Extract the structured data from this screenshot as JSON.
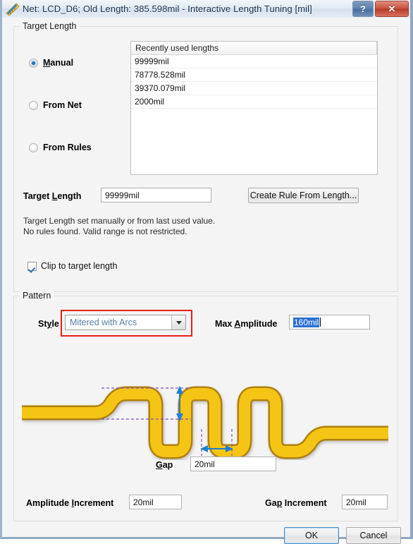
{
  "window": {
    "title": "Net: LCD_D6;  Old Length: 385.598mil -  Interactive Length Tuning [mil]",
    "icon": "ruler-icon",
    "help_label": "?",
    "close_label": "✕"
  },
  "target_length_group": {
    "legend": "Target Length",
    "radios": [
      {
        "label": "Manual",
        "accel": "M",
        "selected": true
      },
      {
        "label": "From Net",
        "accel": "F",
        "selected": false
      },
      {
        "label": "From Rules",
        "accel": "F",
        "selected": false
      }
    ],
    "list": {
      "header": "Recently used lengths",
      "items": [
        "99999mil",
        "78778.528mil",
        "39370.079mil",
        "2000mil"
      ]
    },
    "target_length_label_a": "Target ",
    "target_length_label_b": "L",
    "target_length_label_c": "ength",
    "target_length_value": "99999mil",
    "create_rule_button": "Create Rule From Length...",
    "hint_line1": "Target Length set manually or from last used value.",
    "hint_line2": "No rules found. Valid range is not restricted.",
    "clip_checkbox_label": "Clip to target length",
    "clip_checked": true
  },
  "pattern_group": {
    "legend": "Pattern",
    "style_label_a": "St",
    "style_label_b": "y",
    "style_label_c": "le",
    "style_value": "Mitered with Arcs",
    "style_options": [
      "Mitered with Arcs"
    ],
    "max_amplitude_label_a": "Max ",
    "max_amplitude_label_b": "A",
    "max_amplitude_label_c": "mplitude",
    "max_amplitude_value": "160mil",
    "gap_label_a": "G",
    "gap_label_b": "ap",
    "gap_value": "20mil",
    "amplitude_increment_label_a": "Amplitude ",
    "amplitude_increment_label_b": "I",
    "amplitude_increment_label_c": "ncrement",
    "amplitude_increment_value": "20mil",
    "gap_increment_label_a": "Ga",
    "gap_increment_label_b": "p",
    "gap_increment_label_c": " Increment",
    "gap_increment_value": "20mil"
  },
  "footer": {
    "ok_label": "OK",
    "cancel_label": "Cancel"
  },
  "colors": {
    "trace_fill": "#f5c518",
    "trace_outline": "#b08010",
    "dimension_arrow": "#1f7fd4",
    "guide_line": "#7a4fc0",
    "highlight_box": "#e8201a",
    "selection_blue": "#2b6fd4",
    "dialog_bg": "#f4f4f4"
  }
}
